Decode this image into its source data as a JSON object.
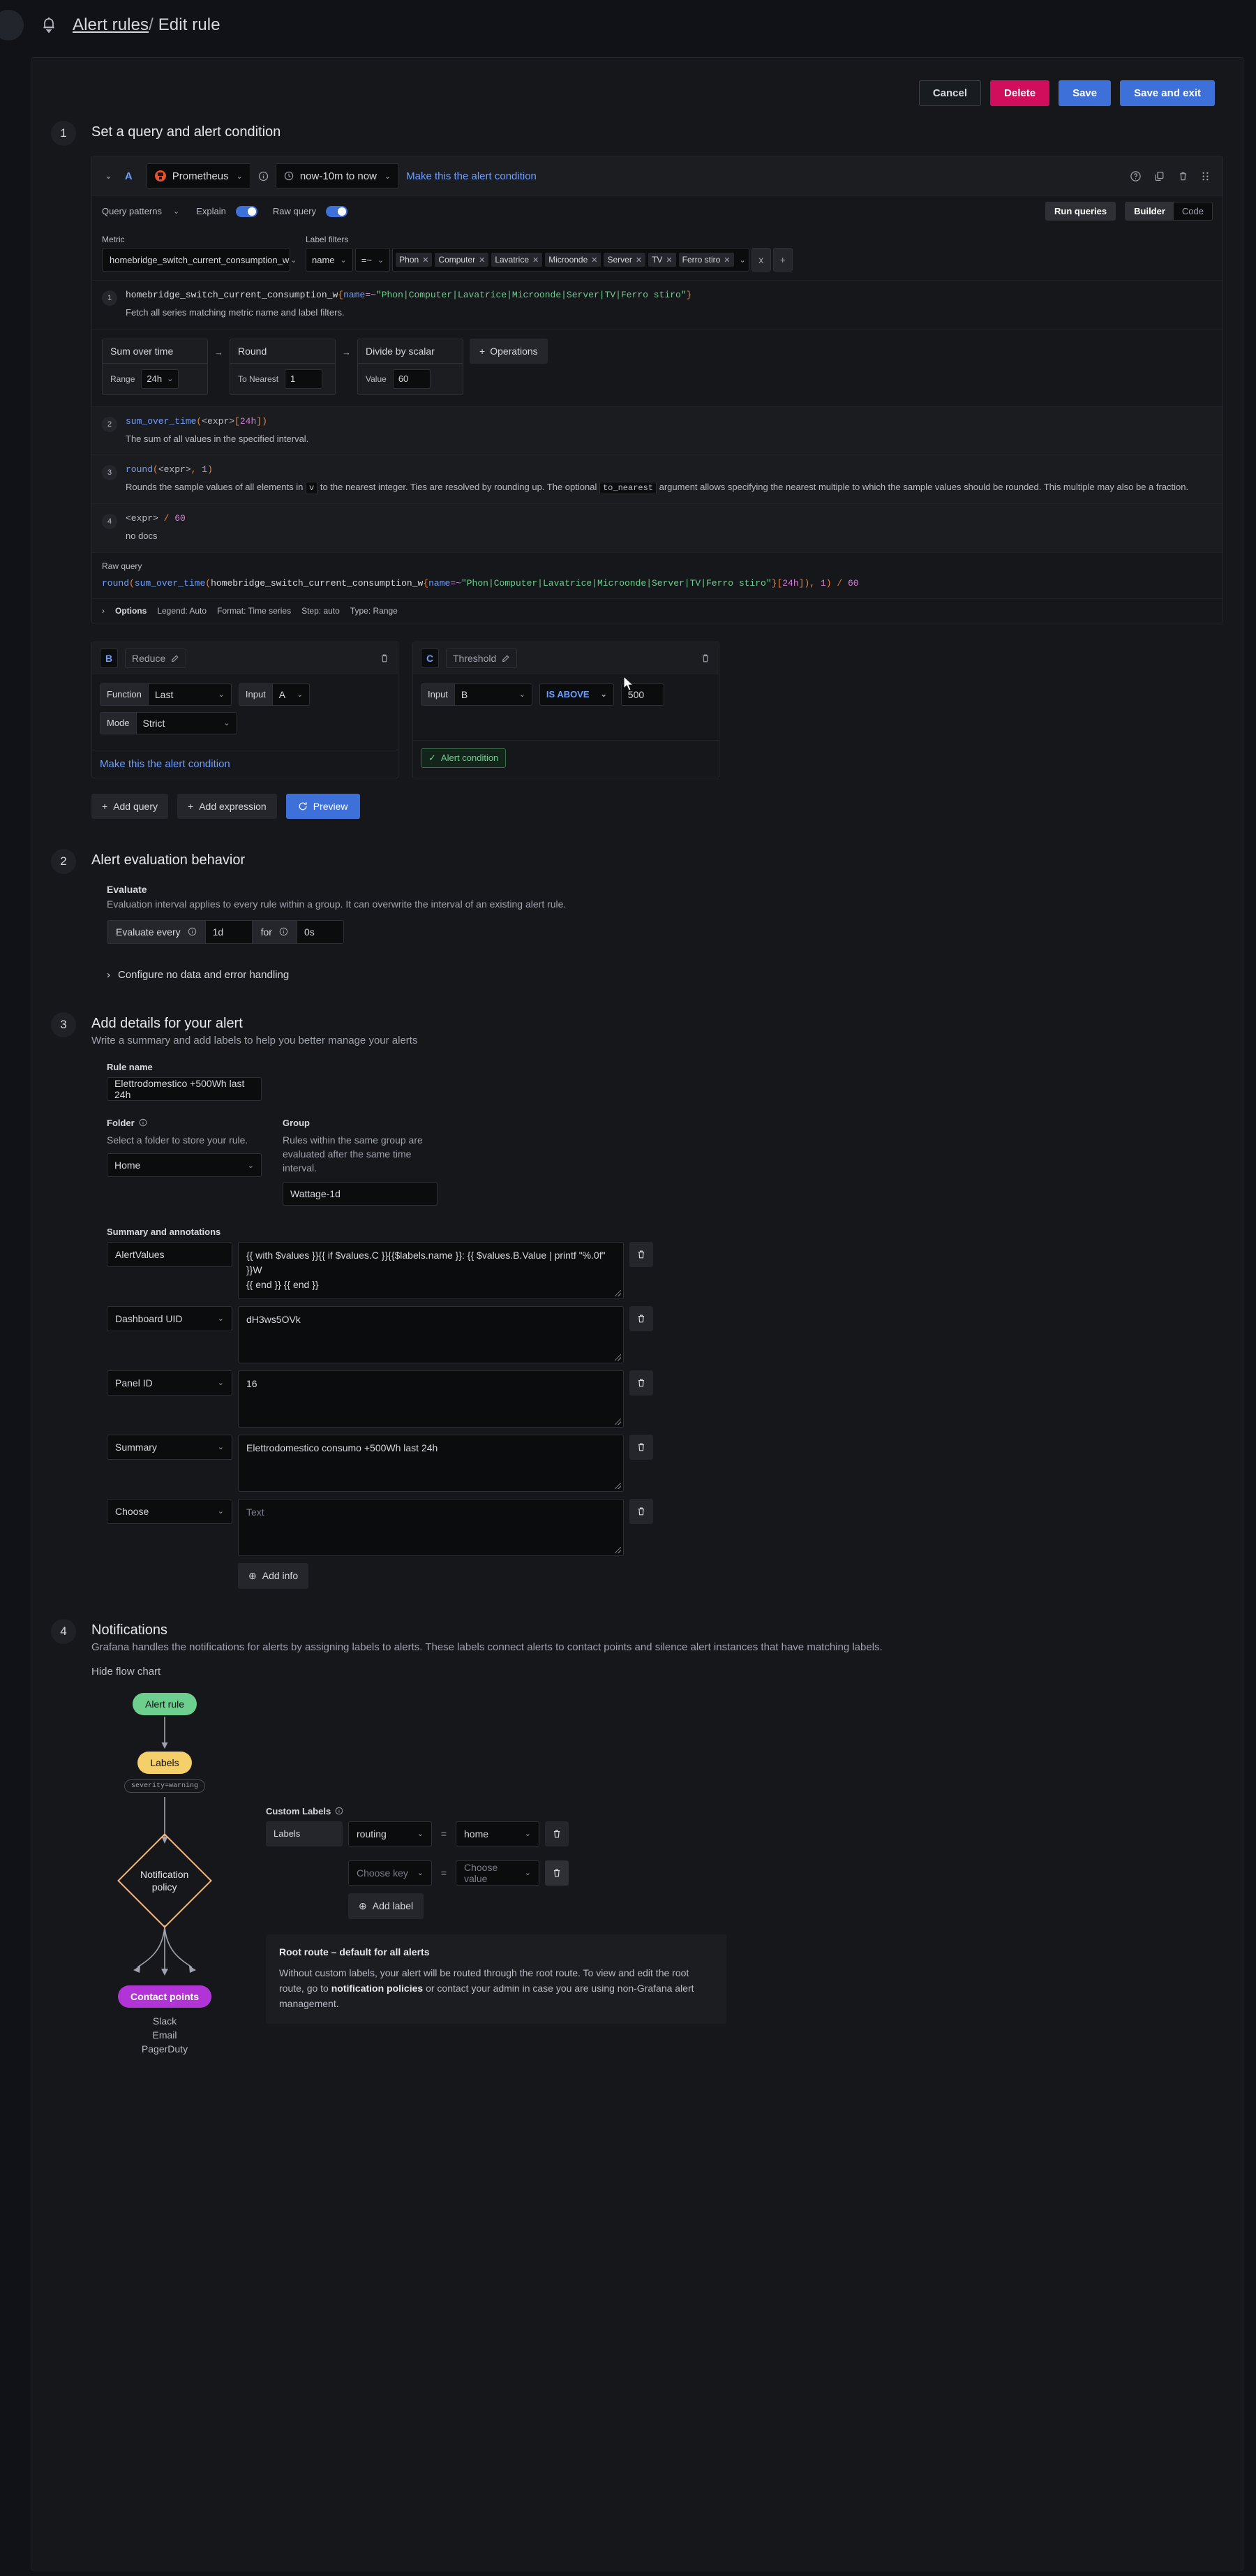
{
  "header": {
    "breadcrumb_parent": "Alert rules",
    "breadcrumb_sep": "/",
    "breadcrumb_current": "Edit rule",
    "bell_icon": "bell-icon"
  },
  "actions": {
    "cancel": "Cancel",
    "delete": "Delete",
    "save": "Save",
    "save_and_exit": "Save and exit"
  },
  "step1": {
    "number": "1",
    "title": "Set a query and alert condition",
    "query": {
      "ref_id": "A",
      "datasource": "Prometheus",
      "time_range": "now-10m to now",
      "make_alert_condition": "Make this the alert condition",
      "query_patterns": "Query patterns",
      "explain_label": "Explain",
      "raw_query_label": "Raw query",
      "run_queries": "Run queries",
      "mode_builder": "Builder",
      "mode_code": "Code",
      "metric_label": "Metric",
      "metric_value": "homebridge_switch_current_consumption_w",
      "label_filters_label": "Label filters",
      "filter_key": "name",
      "filter_op": "=~",
      "filter_values": [
        "Phon",
        "Computer",
        "Lavatrice",
        "Microonde",
        "Server",
        "TV",
        "Ferro stiro"
      ],
      "clear_label": "x",
      "add_label": "+"
    },
    "explain": [
      {
        "num": "1",
        "code_metric": "homebridge_switch_current_consumption_w",
        "code_label": "name",
        "code_op": "=~",
        "code_value": "\"Phon|Computer|Lavatrice|Microonde|Server|TV|Ferro stiro\"",
        "text": "Fetch all series matching metric name and label filters."
      },
      {
        "num": "2",
        "code": "sum_over_time(<expr>[24h])",
        "text": "The sum of all values in the specified interval."
      },
      {
        "num": "3",
        "code": "round(<expr>, 1)",
        "text_1": "Rounds the sample values of all elements in",
        "text_code_1": "v",
        "text_2": "to the nearest integer. Ties are resolved by rounding up. The optional",
        "text_code_2": "to_nearest",
        "text_3": "argument allows specifying the nearest multiple to which the sample values should be rounded. This multiple may also be a fraction."
      },
      {
        "num": "4",
        "code": "<expr> / 60",
        "text": "no docs"
      }
    ],
    "operations": [
      {
        "name": "Sum over time",
        "arg_label": "Range",
        "arg_value": "24h",
        "has_caret": true
      },
      {
        "name": "Round",
        "arg_label": "To Nearest",
        "arg_value": "1",
        "has_caret": false
      },
      {
        "name": "Divide by scalar",
        "arg_label": "Value",
        "arg_value": "60",
        "has_caret": false
      }
    ],
    "operations_button": "Operations",
    "raw_query_title": "Raw query",
    "raw_query_text": "round(sum_over_time(homebridge_switch_current_consumption_w{name=~\"Phon|Computer|Lavatrice|Microonde|Server|TV|Ferro stiro\"}[24h]), 1) / 60",
    "options": {
      "label": "Options",
      "legend": "Legend: Auto",
      "format": "Format: Time series",
      "step": "Step: auto",
      "type": "Type: Range"
    },
    "expr_b": {
      "letter": "B",
      "name": "Reduce",
      "function_label": "Function",
      "function_value": "Last",
      "input_label": "Input",
      "input_value": "A",
      "mode_label": "Mode",
      "mode_value": "Strict",
      "make_alert_condition": "Make this the alert condition"
    },
    "expr_c": {
      "letter": "C",
      "name": "Threshold",
      "input_label": "Input",
      "input_value": "B",
      "operator": "IS ABOVE",
      "threshold_value": "500",
      "alert_condition_badge": "Alert condition"
    },
    "add_query": "Add query",
    "add_expression": "Add expression",
    "preview": "Preview"
  },
  "step2": {
    "number": "2",
    "title": "Alert evaluation behavior",
    "evaluate_label": "Evaluate",
    "evaluate_desc": "Evaluation interval applies to every rule within a group. It can overwrite the interval of an existing alert rule.",
    "evaluate_every_label": "Evaluate every",
    "evaluate_every_value": "1d",
    "for_label": "for",
    "for_value": "0s",
    "configure_nodata": "Configure no data and error handling"
  },
  "step3": {
    "number": "3",
    "title": "Add details for your alert",
    "subtitle": "Write a summary and add labels to help you better manage your alerts",
    "rule_name_label": "Rule name",
    "rule_name_value": "Elettrodomestico +500Wh last 24h",
    "folder_label": "Folder",
    "folder_desc": "Select a folder to store your rule.",
    "folder_value": "Home",
    "group_label": "Group",
    "group_desc": "Rules within the same group are evaluated after the same time interval.",
    "group_value": "Wattage-1d",
    "annotations_label": "Summary and annotations",
    "annotations": [
      {
        "key": "AlertValues",
        "key_is_select": false,
        "value": "{{ with $values }}{{ if $values.C }}{{$labels.name }}: {{ $values.B.Value | printf \"%.0f\" }}W\n{{ end }} {{ end }}",
        "placeholder": ""
      },
      {
        "key": "Dashboard UID",
        "key_is_select": true,
        "value": "dH3ws5OVk",
        "placeholder": ""
      },
      {
        "key": "Panel ID",
        "key_is_select": true,
        "value": "16",
        "placeholder": ""
      },
      {
        "key": "Summary",
        "key_is_select": true,
        "value": "Elettrodomestico consumo +500Wh last 24h",
        "placeholder": ""
      },
      {
        "key": "Choose",
        "key_is_select": true,
        "value": "",
        "placeholder": "Text"
      }
    ],
    "add_info": "Add info"
  },
  "step4": {
    "number": "4",
    "title": "Notifications",
    "desc": "Grafana handles the notifications for alerts by assigning labels to alerts. These labels connect alerts to contact points and silence alert instances that have matching labels.",
    "hide_flow_chart": "Hide flow chart",
    "flow": {
      "alert_rule": "Alert rule",
      "labels": "Labels",
      "labels_tag": "severity=warning",
      "notification_policy": "Notification policy",
      "contact_points": "Contact points",
      "contact_point_list": [
        "Slack",
        "Email",
        "PagerDuty"
      ]
    },
    "custom_labels_title": "Custom Labels",
    "labels_static": "Labels",
    "label_rows": [
      {
        "key": "routing",
        "eq": "=",
        "value": "home",
        "key_placeholder": false,
        "value_placeholder": false
      },
      {
        "key": "Choose key",
        "eq": "=",
        "value": "Choose value",
        "key_placeholder": true,
        "value_placeholder": true
      }
    ],
    "add_label": "Add label",
    "root_route_title": "Root route – default for all alerts",
    "root_route_text_1": "Without custom labels, your alert will be routed through the root route. To view and edit the root route, go to ",
    "root_route_link": "notification policies",
    "root_route_text_2": " or contact your admin in case you are using non-Grafana alert management."
  },
  "colors": {
    "accent_blue": "#3d71d9",
    "danger_pink": "#d10e5c",
    "green": "#6ccf8e",
    "yellow": "#f5d06a",
    "purple": "#b234d6",
    "orange": "#f5b678",
    "prometheus_orange": "#e6522c"
  }
}
